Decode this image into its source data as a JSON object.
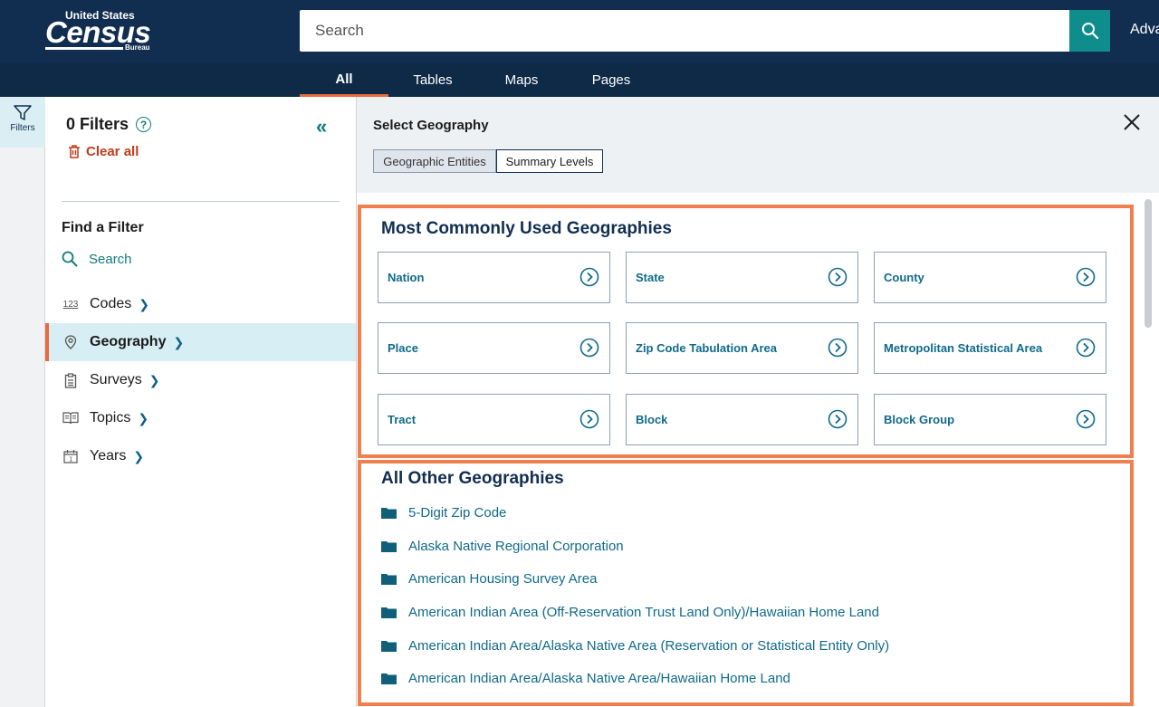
{
  "header": {
    "logo": {
      "line1": "United States",
      "line2": "Census",
      "line3": "Bureau"
    },
    "search_placeholder": "Search",
    "advanced_label": "Adva",
    "brand_color": "#112e51",
    "accent_color": "#0f8d8d"
  },
  "tabs": [
    {
      "label": "All",
      "active": true
    },
    {
      "label": "Tables",
      "active": false
    },
    {
      "label": "Maps",
      "active": false
    },
    {
      "label": "Pages",
      "active": false
    }
  ],
  "rail": {
    "filters_label": "Filters",
    "icon": "filter-icon"
  },
  "filter_panel": {
    "title": "0 Filters",
    "help_icon": "?",
    "clear_label": "Clear all",
    "collapse_icon": "«",
    "find_title": "Find a Filter",
    "search_label": "Search",
    "items": [
      {
        "label": "Codes",
        "icon": "123",
        "active": false
      },
      {
        "label": "Geography",
        "icon": "map-pin-icon",
        "active": true
      },
      {
        "label": "Surveys",
        "icon": "clipboard-icon",
        "active": false
      },
      {
        "label": "Topics",
        "icon": "book-icon",
        "active": false
      },
      {
        "label": "Years",
        "icon": "calendar-icon",
        "active": false
      }
    ]
  },
  "geography_panel": {
    "title": "Select Geography",
    "segments": [
      "Geographic Entities",
      "Summary Levels"
    ],
    "active_segment": "Geographic Entities",
    "common_title": "Most Commonly Used Geographies",
    "common": [
      "Nation",
      "State",
      "County",
      "Place",
      "Zip Code Tabulation Area",
      "Metropolitan Statistical Area",
      "Tract",
      "Block",
      "Block Group"
    ],
    "other_title": "All Other Geographies",
    "other": [
      "5-Digit Zip Code",
      "Alaska Native Regional Corporation",
      "American Housing Survey Area",
      "American Indian Area (Off-Reservation Trust Land Only)/Hawaiian Home Land",
      "American Indian Area/Alaska Native Area (Reservation or Statistical Entity Only)",
      "American Indian Area/Alaska Native Area/Hawaiian Home Land"
    ],
    "highlight_color": "#f07e4e"
  }
}
